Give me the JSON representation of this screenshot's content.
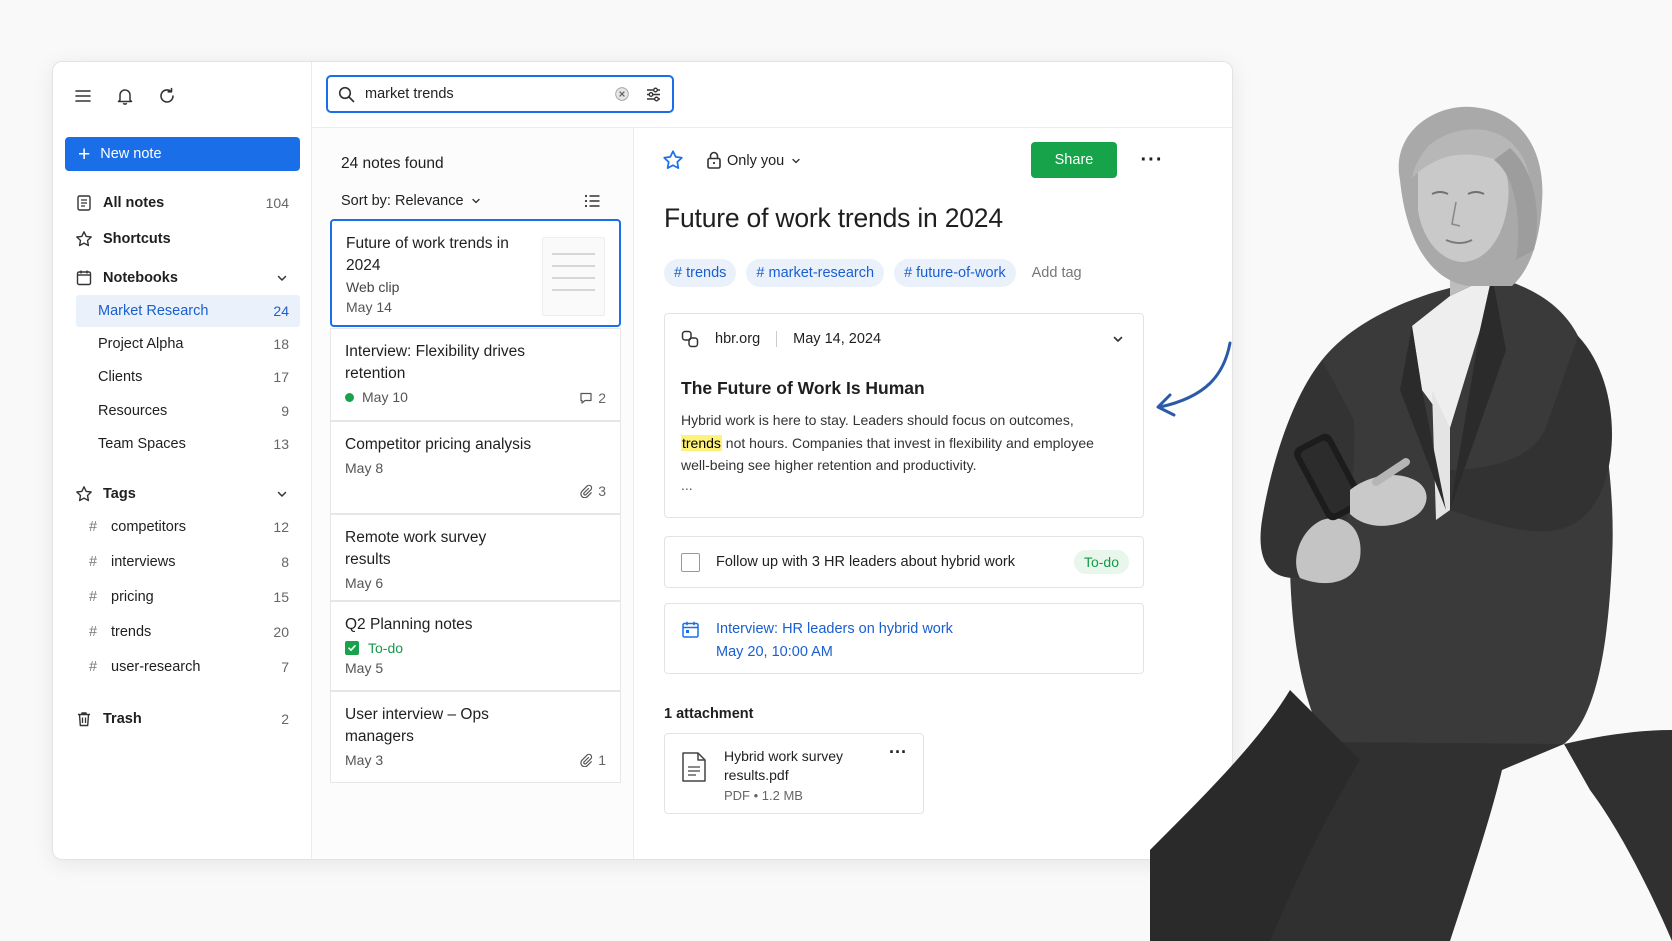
{
  "sidebar": {
    "new_note_label": "New note",
    "all_notes": {
      "label": "All notes",
      "count": "104"
    },
    "shortcuts": {
      "label": "Shortcuts"
    },
    "notebooks": {
      "label": "Notebooks",
      "items": [
        {
          "label": "Market Research",
          "count": "24"
        },
        {
          "label": "Project Alpha",
          "count": "18"
        },
        {
          "label": "Clients",
          "count": "17"
        },
        {
          "label": "Resources",
          "count": "9"
        },
        {
          "label": "Team Spaces",
          "count": "13"
        }
      ]
    },
    "tags": {
      "label": "Tags",
      "items": [
        {
          "label": "competitors",
          "count": "12"
        },
        {
          "label": "interviews",
          "count": "8"
        },
        {
          "label": "pricing",
          "count": "15"
        },
        {
          "label": "trends",
          "count": "20"
        },
        {
          "label": "user-research",
          "count": "7"
        }
      ]
    },
    "trash": {
      "label": "Trash",
      "count": "2"
    }
  },
  "search": {
    "value": "market trends"
  },
  "list": {
    "found_label": "24 notes found",
    "sort_label": "Sort by: Relevance",
    "notes": [
      {
        "title": "Future of work trends in 2024",
        "sub": "Web clip",
        "date": "May 14"
      },
      {
        "title": "Interview: Flexibility drives retention",
        "date": "May 10",
        "meta": "2"
      },
      {
        "title": "Competitor pricing analysis",
        "date": "May 8",
        "meta": "3"
      },
      {
        "title": "Remote work survey results",
        "date": "May 6"
      },
      {
        "title": "Q2 Planning notes",
        "todo": "To-do",
        "date": "May 5"
      },
      {
        "title": "User interview – Ops managers",
        "date": "May 3",
        "meta": "1"
      }
    ]
  },
  "detail": {
    "share_scope": "Only you",
    "share_label": "Share",
    "more_label": "···",
    "title": "Future of work trends in 2024",
    "tags": [
      "# trends",
      "# market-research",
      "# future-of-work"
    ],
    "add_tag_label": "Add tag",
    "clip": {
      "source": "hbr.org",
      "date": "May 14, 2024",
      "title": "The Future of Work Is Human",
      "body_1": "Hybrid work is here to stay. Leaders should focus on outcomes,",
      "body_highlight": "trends",
      "body_2": " not hours. Companies that invest in flexibility and employee well-being see higher retention and productivity.",
      "ellipsis": "..."
    },
    "task": {
      "text": "Follow up with 3 HR leaders about hybrid work",
      "badge": "To-do"
    },
    "event": {
      "title": "Interview: HR leaders on hybrid work",
      "when": "May 20, 10:00 AM"
    },
    "attachments_label": "1 attachment",
    "attachment": {
      "name": "Hybrid work survey results.pdf",
      "info": "PDF • 1.2 MB",
      "more": "···"
    }
  },
  "colors": {
    "accent": "#1a6ee8",
    "share": "#16a34a",
    "highlight": "#fff27a"
  },
  "icons": [
    "menu-icon",
    "bell-icon",
    "refresh-icon",
    "search-icon",
    "clear-icon",
    "filter-icon",
    "star-icon",
    "lock-icon",
    "link-icon",
    "calendar-icon",
    "file-icon",
    "paperclip-icon",
    "comment-icon",
    "trash-icon",
    "notebook-icon",
    "note-icon"
  ]
}
